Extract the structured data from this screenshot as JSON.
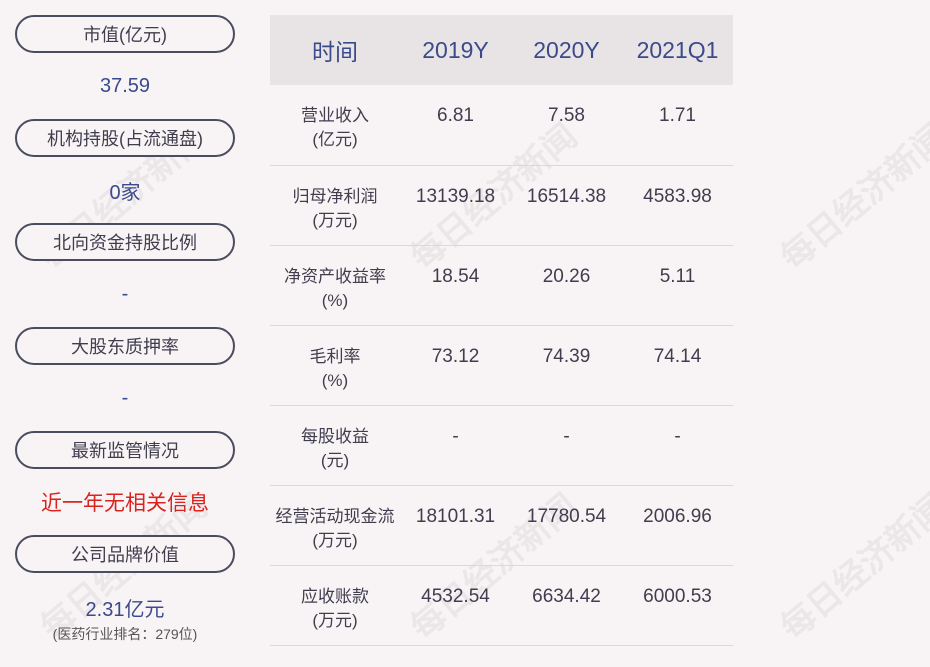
{
  "left_panel": {
    "items": [
      {
        "label": "市值(亿元)",
        "value": "37.59"
      },
      {
        "label": "机构持股(占流通盘)",
        "value": "0家"
      },
      {
        "label": "北向资金持股比例",
        "value": "-"
      },
      {
        "label": "大股东质押率",
        "value": "-"
      },
      {
        "label": "最新监管情况",
        "value": "近一年无相关信息"
      },
      {
        "label": "公司品牌价值",
        "value": "2.31亿元",
        "sub": "(医药行业排名：279位)"
      }
    ]
  },
  "table": {
    "headers": [
      "时间",
      "2019Y",
      "2020Y",
      "2021Q1"
    ],
    "rows": [
      {
        "label1": "营业收入",
        "label2": "(亿元)",
        "values": [
          "6.81",
          "7.58",
          "1.71"
        ]
      },
      {
        "label1": "归母净利润",
        "label2": "(万元)",
        "values": [
          "13139.18",
          "16514.38",
          "4583.98"
        ]
      },
      {
        "label1": "净资产收益率",
        "label2": "(%)",
        "values": [
          "18.54",
          "20.26",
          "5.11"
        ]
      },
      {
        "label1": "毛利率",
        "label2": "(%)",
        "values": [
          "73.12",
          "74.39",
          "74.14"
        ]
      },
      {
        "label1": "每股收益",
        "label2": "(元)",
        "values": [
          "-",
          "-",
          "-"
        ]
      },
      {
        "label1": "经营活动现金流",
        "label2": "(万元)",
        "values": [
          "18101.31",
          "17780.54",
          "2006.96"
        ]
      },
      {
        "label1": "应收账款",
        "label2": "(万元)",
        "values": [
          "4532.54",
          "6634.42",
          "6000.53"
        ]
      }
    ]
  },
  "watermark": "每日经济新闻",
  "colors": {
    "accent": "#3a4a8a",
    "alert": "#d9231f",
    "header_bg": "#e8e4e5"
  }
}
